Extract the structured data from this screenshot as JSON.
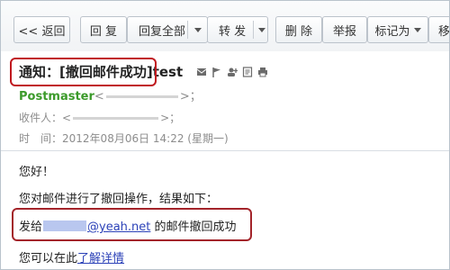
{
  "toolbar": {
    "back": "<< 返回",
    "reply": "回 复",
    "reply_all": "回复全部",
    "forward": "转 发",
    "delete": "删 除",
    "report": "举报",
    "mark_as": "标记为",
    "move": "移"
  },
  "message": {
    "subject": "通知：[撤回邮件成功]test",
    "sender_name": "Postmaster",
    "sender_addr_open": "<",
    "sender_addr_close": ">；",
    "recipient_label": "收件人：",
    "recipient_open": "<",
    "recipient_close": ">；",
    "time_label": "时　间：",
    "time_value": "2012年08月06日 14:22 (星期一)"
  },
  "body": {
    "greeting": "您好！",
    "intro": "您对邮件进行了撤回操作，结果如下：",
    "result_prefix": "发给",
    "result_email": "@yeah.net",
    "result_suffix": " 的邮件撤回成功",
    "detail_prefix": "您可以在此",
    "detail_link": "了解详情"
  },
  "colors": {
    "highlight_border": "#c0191f",
    "sender_green": "#3b9a2a",
    "link_blue": "#2c42b8"
  },
  "icons": [
    "mail-status-icon",
    "flag-icon",
    "add-contact-icon",
    "note-icon",
    "print-icon"
  ]
}
